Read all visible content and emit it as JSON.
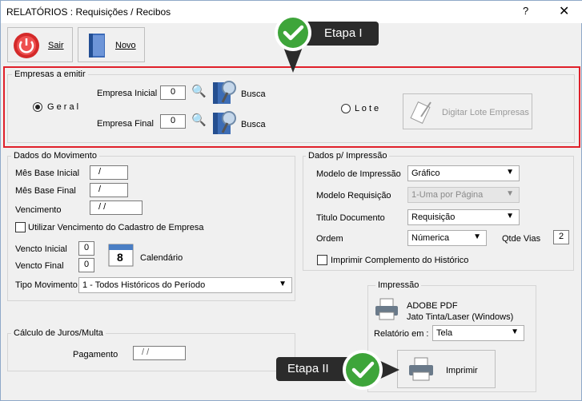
{
  "window": {
    "title": "RELATÓRIOS : Requisições / Recibos",
    "help": "?",
    "close": "✕"
  },
  "toolbar": {
    "sair": "Sair",
    "novo": "Novo"
  },
  "callouts": {
    "etapa1": "Etapa I",
    "etapa2": "Etapa II"
  },
  "empresas": {
    "legend": "Empresas a emitir",
    "geral": "G e r a l",
    "inicial_label": "Empresa Inicial",
    "inicial_value": "0",
    "final_label": "Empresa Final",
    "final_value": "0",
    "busca": "Busca",
    "lote": "L o t e",
    "digitar_lote": "Digitar Lote Empresas"
  },
  "movimento": {
    "legend": "Dados do Movimento",
    "mes_inicial_label": "Mês Base Inicial",
    "mes_inicial_value": "/",
    "mes_final_label": "Mês Base Final",
    "mes_final_value": "/",
    "vencimento_label": "Vencimento",
    "vencimento_value": "/ /",
    "utilizar_label": "Utilizar Vencimento do Cadastro de Empresa",
    "vencto_inicial_label": "Vencto Inicial",
    "vencto_inicial_value": "0",
    "vencto_final_label": "Vencto Final",
    "vencto_final_value": "0",
    "calendario": "Calendário",
    "calendar_day": "8",
    "tipo_label": "Tipo Movimento",
    "tipo_value": "1 - Todos Históricos do Período"
  },
  "juros": {
    "legend": "Cálculo de Juros/Multa",
    "pagamento_label": "Pagamento",
    "pagamento_value": "/ /"
  },
  "impressao_dados": {
    "legend": "Dados p/ Impressão",
    "modelo_impressao_label": "Modelo de Impressão",
    "modelo_impressao_value": "Gráfico",
    "modelo_requisicao_label": "Modelo Requisição",
    "modelo_requisicao_value": "1-Uma  por Página",
    "titulo_label": "Titulo Documento",
    "titulo_value": "Requisição",
    "ordem_label": "Ordem",
    "ordem_value": "Númerica",
    "qtde_label": "Qtde Vias",
    "qtde_value": "2",
    "complemento_label": "Imprimir Complemento do Histórico"
  },
  "impressao": {
    "legend": "Impressão",
    "printer_name": "ADOBE PDF",
    "printer_type": "Jato Tinta/Laser (Windows)",
    "relatorio_label": "Relatório em :",
    "relatorio_value": "Tela",
    "imprimir": "Imprimir"
  },
  "colors": {
    "accent_red": "#e0202a",
    "callout_bg": "#2b2b2b",
    "check_green": "#3ea53a"
  }
}
